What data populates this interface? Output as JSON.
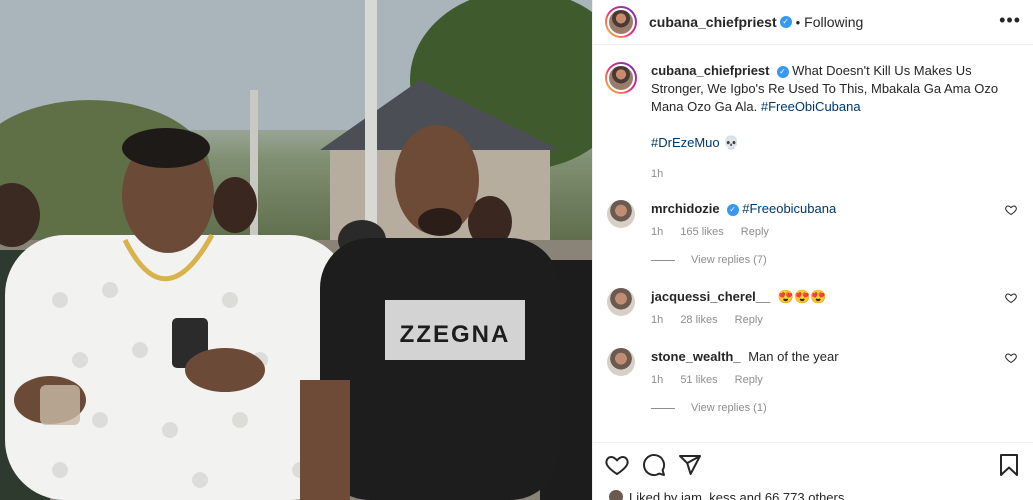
{
  "post": {
    "author": "cubana_chiefpriest",
    "follow_status": "Following",
    "more_icon": "more-horizontal-icon",
    "caption_text": "What Doesn't Kill Us Makes Us Stronger, We Igbo's Re Used To This, Mbakala Ga Ama Ozo Mana Ozo Ga Ala.",
    "caption_hashtag1": "#FreeObiCubana",
    "caption_hashtag2": "#DrEzeMuo",
    "caption_emoji": "💀",
    "caption_time": "1h",
    "photo_shirt_text": "ZZEGNA"
  },
  "comments": [
    {
      "user": "mrchidozie",
      "verified": true,
      "text": "#Freeobicubana",
      "time": "1h",
      "likes": "165 likes",
      "reply_label": "Reply",
      "view_replies": "View replies (7)"
    },
    {
      "user": "jacquessi_cherel__",
      "verified": false,
      "text": "😍😍😍",
      "time": "1h",
      "likes": "28 likes",
      "reply_label": "Reply"
    },
    {
      "user": "stone_wealth_",
      "verified": false,
      "text": "Man of the year",
      "time": "1h",
      "likes": "51 likes",
      "reply_label": "Reply",
      "view_replies": "View replies (1)"
    }
  ],
  "footer": {
    "liked_by": "Liked by iam_kess and 66,773 others"
  },
  "colors": {
    "verified": "#3897f0",
    "hashtag": "#00376b",
    "muted": "#8e8e8e"
  }
}
